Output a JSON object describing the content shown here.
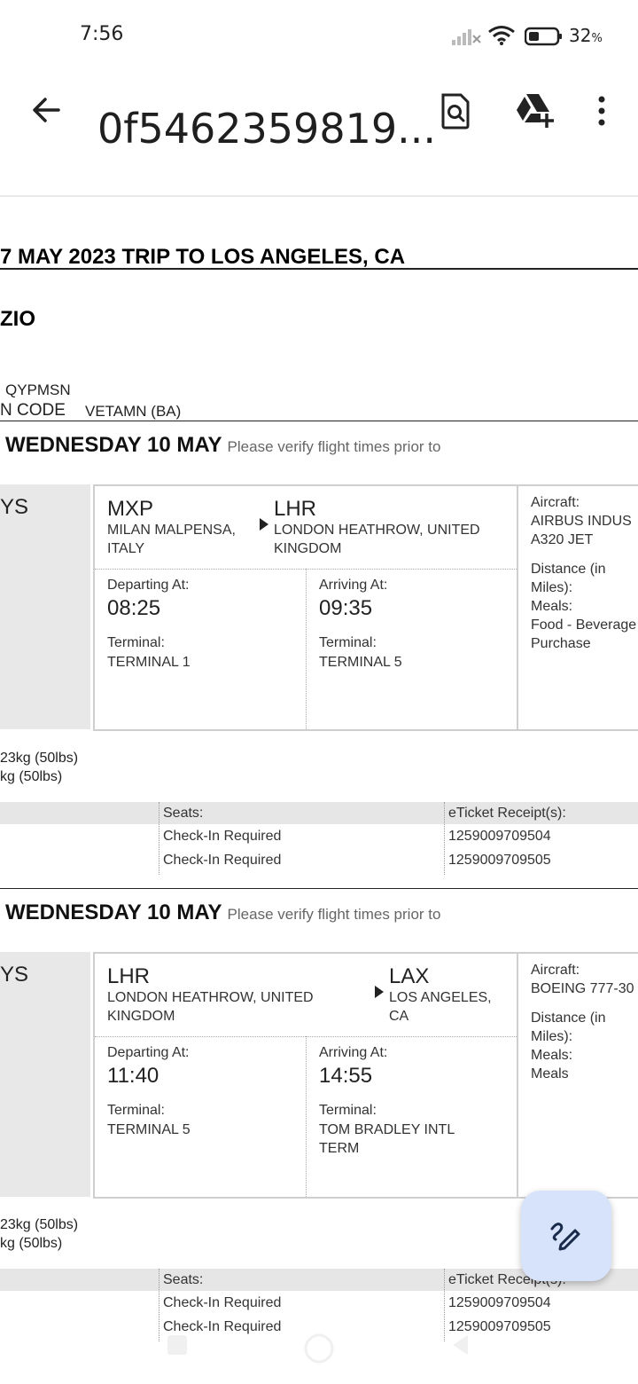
{
  "status": {
    "time": "7:56",
    "battery": "32",
    "battery_unit": "%"
  },
  "appbar": {
    "title": "0f5462359819..."
  },
  "trip": {
    "title": "7 MAY 2023 TRIP TO LOS ANGELES, CA",
    "name": "ZIO",
    "conf_value": "QYPMSN",
    "conf_label": "N CODE",
    "conf_value2": "VETAMN (BA)"
  },
  "flights": [
    {
      "day": "WEDNESDAY 10 MAY",
      "note": "Please verify flight times prior to",
      "airline_fragment": "YS",
      "from_code": "MXP",
      "from_city": "MILAN MALPENSA, ITALY",
      "to_code": "LHR",
      "to_city": "LONDON HEATHROW, UNITED KINGDOM",
      "departing_label": "Departing At:",
      "departing_time": "08:25",
      "dep_terminal_label": "Terminal:",
      "dep_terminal": "TERMINAL 1",
      "arriving_label": "Arriving At:",
      "arriving_time": "09:35",
      "arr_terminal_label": "Terminal:",
      "arr_terminal": "TERMINAL 5",
      "side": [
        "Aircraft:",
        "AIRBUS INDUS",
        "A320 JET",
        "",
        "Distance (in",
        "Miles):",
        "Meals:",
        "Food - Beverage",
        "Purchase"
      ],
      "bag1": "23kg (50lbs)",
      "bag2": "kg (50lbs)",
      "seats_label": "Seats:",
      "seat1": "Check-In Required",
      "seat2": "Check-In Required",
      "eticket_label": "eTicket Receipt(s):",
      "ticket1": "1259009709504",
      "ticket2": "1259009709505"
    },
    {
      "day": "WEDNESDAY 10 MAY",
      "note": "Please verify flight times prior to",
      "airline_fragment": "YS",
      "from_code": "LHR",
      "from_city": "LONDON HEATHROW, UNITED KINGDOM",
      "to_code": "LAX",
      "to_city": "LOS ANGELES, CA",
      "departing_label": "Departing At:",
      "departing_time": "11:40",
      "dep_terminal_label": "Terminal:",
      "dep_terminal": "TERMINAL 5",
      "arriving_label": "Arriving At:",
      "arriving_time": "14:55",
      "arr_terminal_label": "Terminal:",
      "arr_terminal": "TOM BRADLEY INTL TERM",
      "side": [
        "Aircraft:",
        "BOEING 777-30",
        "",
        "Distance (in",
        "Miles):",
        "Meals:",
        "Meals"
      ],
      "bag1": "23kg (50lbs)",
      "bag2": "kg (50lbs)",
      "seats_label": "Seats:",
      "seat1": "Check-In Required",
      "seat2": "Check-In Required",
      "eticket_label": "eTicket Receipt(s):",
      "ticket1": "1259009709504",
      "ticket2": "1259009709505"
    }
  ],
  "icons": {
    "back": "arrow-left-icon",
    "search_doc": "document-search-icon",
    "drive_add": "drive-add-icon",
    "more": "more-vertical-icon",
    "edit": "edit-pen-icon"
  },
  "colors": {
    "fab_bg": "#d7e3fb",
    "row_header_bg": "#e6e6e6"
  }
}
